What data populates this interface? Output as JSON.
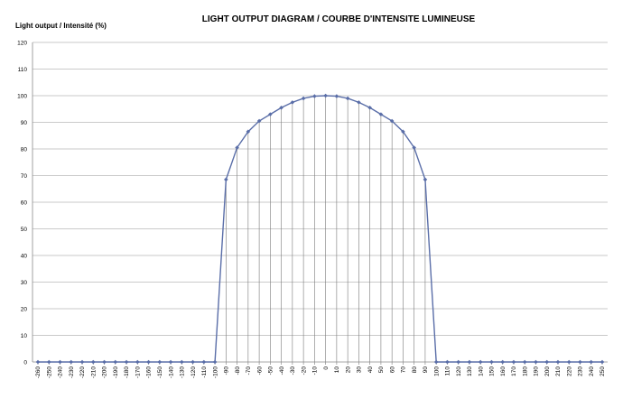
{
  "chart_data": {
    "type": "line",
    "title": "LIGHT OUTPUT DIAGRAM / COURBE D'INTENSITE LUMINEUSE",
    "ylabel": "Light output / Intensité (%)",
    "xlabel": "",
    "ylim": [
      0,
      120
    ],
    "y_ticks": [
      "0",
      "10",
      "20",
      "30",
      "40",
      "50",
      "60",
      "70",
      "80",
      "90",
      "100",
      "110",
      "120"
    ],
    "x": [
      -260,
      -250,
      -240,
      -230,
      -220,
      -210,
      -200,
      -190,
      -180,
      -170,
      -160,
      -150,
      -140,
      -130,
      -120,
      -110,
      -100,
      -90,
      -80,
      -70,
      -60,
      -50,
      -40,
      -30,
      -20,
      -10,
      0,
      10,
      20,
      30,
      40,
      50,
      60,
      70,
      80,
      90,
      100,
      110,
      120,
      130,
      140,
      150,
      160,
      170,
      180,
      190,
      200,
      210,
      220,
      230,
      240,
      250
    ],
    "x_tick_labels": [
      "-260",
      "-250",
      "-240",
      "-230",
      "-220",
      "-210",
      "-200",
      "-190",
      "-180",
      "-170",
      "-160",
      "-150",
      "-140",
      "-130",
      "-120",
      "-110",
      "-100",
      "-90",
      "-80",
      "-70",
      "-60",
      "-50",
      "-40",
      "-30",
      "-20",
      "-10",
      "0",
      "10",
      "20",
      "30",
      "40",
      "50",
      "60",
      "70",
      "80",
      "90",
      "100",
      "110",
      "120",
      "130",
      "140",
      "150",
      "160",
      "170",
      "180",
      "190",
      "200",
      "210",
      "220",
      "230",
      "240",
      "250"
    ],
    "series": [
      {
        "values": [
          0,
          0,
          0,
          0,
          0,
          0,
          0,
          0,
          0,
          0,
          0,
          0,
          0,
          0,
          0,
          0,
          0,
          68.5,
          80.5,
          86.5,
          90.5,
          93,
          95.5,
          97.5,
          99,
          99.8,
          100,
          99.8,
          99,
          97.5,
          95.5,
          93,
          90.5,
          86.5,
          80.5,
          68.5,
          0,
          0,
          0,
          0,
          0,
          0,
          0,
          0,
          0,
          0,
          0,
          0,
          0,
          0,
          0,
          0
        ],
        "color": "#5A6EA8"
      }
    ],
    "grid": "horizontal",
    "drop_lines": true,
    "legend": "none"
  }
}
